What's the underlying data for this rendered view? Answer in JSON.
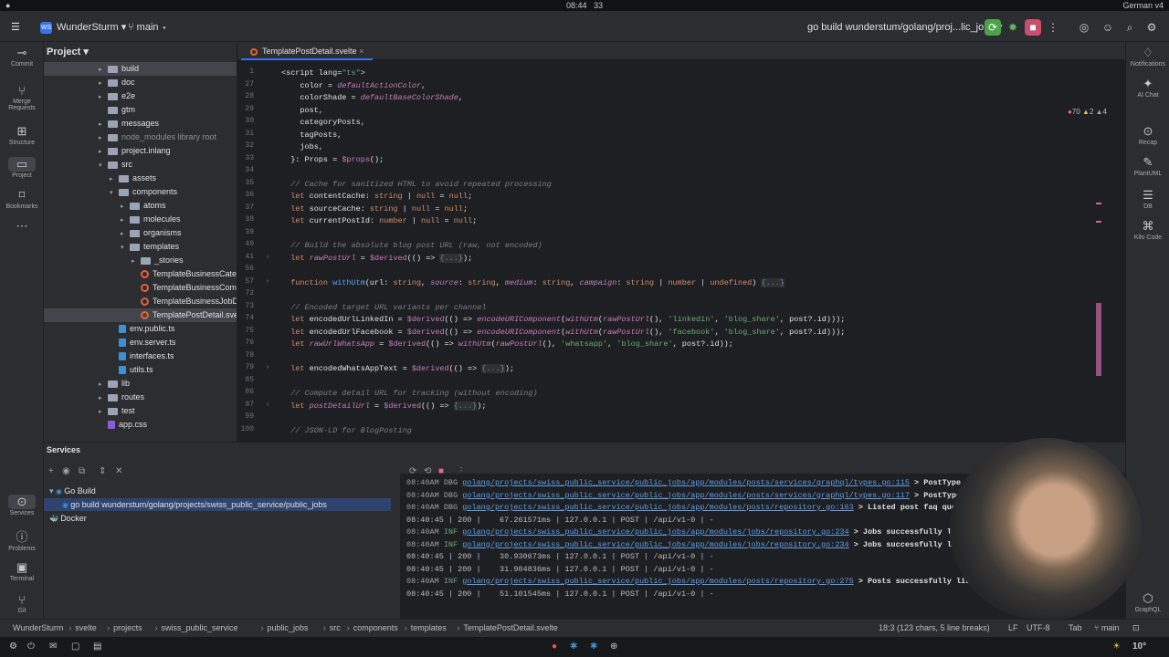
{
  "system": {
    "time": "08:44",
    "notif_count": "33",
    "language": "German",
    "version_label": "v4"
  },
  "titlebar": {
    "project_badge": "WS",
    "project_name": "WunderSturm",
    "branch": "main",
    "run_config": "go build wunderstum/golang/proj...lic_jobs"
  },
  "left_strip": [
    {
      "label": "Commit",
      "icon": "commit-icon"
    },
    {
      "label": "Merge Requests",
      "icon": "merge-icon"
    },
    {
      "label": "Structure",
      "icon": "structure-icon"
    },
    {
      "label": "Project",
      "icon": "folder-icon"
    },
    {
      "label": "Bookmarks",
      "icon": "bookmark-icon"
    }
  ],
  "left_strip_bottom": [
    {
      "label": "Services",
      "icon": "services-icon"
    },
    {
      "label": "Problems",
      "icon": "problems-icon"
    },
    {
      "label": "Terminal",
      "icon": "terminal-icon"
    },
    {
      "label": "Git",
      "icon": "git-icon"
    }
  ],
  "right_strip": [
    {
      "label": "Notifications"
    },
    {
      "label": "AI Chat"
    },
    {
      "label": "Recap"
    },
    {
      "label": "PlantUML"
    },
    {
      "label": "DB"
    },
    {
      "label": "Kilo Code"
    },
    {
      "label": "GraphQL"
    }
  ],
  "project_panel": {
    "title": "Project",
    "tree": [
      {
        "label": "build",
        "indent": 1,
        "kind": "folder",
        "arrow": ">",
        "style": "sel"
      },
      {
        "label": "doc",
        "indent": 1,
        "kind": "folder",
        "arrow": ">"
      },
      {
        "label": "e2e",
        "indent": 1,
        "kind": "folder",
        "arrow": ">"
      },
      {
        "label": "gtm",
        "indent": 1,
        "kind": "folder",
        "arrow": ""
      },
      {
        "label": "messages",
        "indent": 1,
        "kind": "folder",
        "arrow": ">"
      },
      {
        "label": "node_modules  library root",
        "indent": 1,
        "kind": "folder",
        "arrow": ">",
        "style": "dim"
      },
      {
        "label": "project.inlang",
        "indent": 1,
        "kind": "folder",
        "arrow": ">"
      },
      {
        "label": "src",
        "indent": 1,
        "kind": "folder",
        "arrow": "v"
      },
      {
        "label": "assets",
        "indent": 2,
        "kind": "folder",
        "arrow": ">"
      },
      {
        "label": "components",
        "indent": 2,
        "kind": "folder",
        "arrow": "v"
      },
      {
        "label": "atoms",
        "indent": 3,
        "kind": "folder",
        "arrow": ">"
      },
      {
        "label": "molecules",
        "indent": 3,
        "kind": "folder",
        "arrow": ">"
      },
      {
        "label": "organisms",
        "indent": 3,
        "kind": "folder",
        "arrow": ">"
      },
      {
        "label": "templates",
        "indent": 3,
        "kind": "folder",
        "arrow": "v"
      },
      {
        "label": "_stories",
        "indent": 4,
        "kind": "folder",
        "arrow": ">"
      },
      {
        "label": "TemplateBusinessCateg",
        "indent": 4,
        "kind": "svelte",
        "arrow": ""
      },
      {
        "label": "TemplateBusinessCompa",
        "indent": 4,
        "kind": "svelte",
        "arrow": ""
      },
      {
        "label": "TemplateBusinessJobDe",
        "indent": 4,
        "kind": "svelte",
        "arrow": ""
      },
      {
        "label": "TemplatePostDetail.svelt",
        "indent": 4,
        "kind": "svelte",
        "arrow": "",
        "style": "sel"
      },
      {
        "label": "env.public.ts",
        "indent": 2,
        "kind": "ts",
        "arrow": ""
      },
      {
        "label": "env.server.ts",
        "indent": 2,
        "kind": "ts",
        "arrow": ""
      },
      {
        "label": "interfaces.ts",
        "indent": 2,
        "kind": "ts",
        "arrow": ""
      },
      {
        "label": "utils.ts",
        "indent": 2,
        "kind": "ts",
        "arrow": ""
      },
      {
        "label": "lib",
        "indent": 1,
        "kind": "folder",
        "arrow": ">"
      },
      {
        "label": "routes",
        "indent": 1,
        "kind": "folder",
        "arrow": ">"
      },
      {
        "label": "test",
        "indent": 1,
        "kind": "folder",
        "arrow": ">"
      },
      {
        "label": "app.css",
        "indent": 1,
        "kind": "css",
        "arrow": ""
      }
    ]
  },
  "editor": {
    "tab": "TemplatePostDetail.svelte",
    "inspections": {
      "warn": "70",
      "weak": "2",
      "typo": "4"
    },
    "lines": [
      {
        "n": "1",
        "fold": "",
        "parts": [
          [
            "ty",
            "<script lang="
          ],
          [
            "s",
            "\"ts\""
          ],
          [
            "ty",
            ">"
          ]
        ]
      },
      {
        "n": "27",
        "fold": "",
        "parts": [
          [
            "ty",
            "    "
          ],
          [
            "ty",
            "color"
          ],
          [
            "ty",
            " = "
          ],
          [
            "it",
            "defaultActionColor"
          ],
          [
            "ty",
            ","
          ]
        ]
      },
      {
        "n": "28",
        "fold": "",
        "parts": [
          [
            "ty",
            "    colorShade = "
          ],
          [
            "it",
            "defaultBaseColorShade"
          ],
          [
            "ty",
            ","
          ]
        ]
      },
      {
        "n": "29",
        "fold": "",
        "parts": [
          [
            "ty",
            "    post,"
          ]
        ]
      },
      {
        "n": "30",
        "fold": "",
        "parts": [
          [
            "ty",
            "    categoryPosts,"
          ]
        ]
      },
      {
        "n": "31",
        "fold": "",
        "parts": [
          [
            "ty",
            "    tagPosts,"
          ]
        ]
      },
      {
        "n": "32",
        "fold": "",
        "parts": [
          [
            "ty",
            "    jobs,"
          ]
        ]
      },
      {
        "n": "33",
        "fold": "",
        "parts": [
          [
            "ty",
            "  }: Props = "
          ],
          [
            "pr",
            "$props"
          ],
          [
            "ty",
            "();"
          ]
        ]
      },
      {
        "n": "34",
        "fold": "",
        "parts": []
      },
      {
        "n": "35",
        "fold": "",
        "parts": [
          [
            "cm",
            "  // Cache for sanitized HTML to avoid repeated processing"
          ]
        ]
      },
      {
        "n": "36",
        "fold": "",
        "parts": [
          [
            "k",
            "  let "
          ],
          [
            "ty",
            "contentCache: "
          ],
          [
            "k",
            "string"
          ],
          [
            "ty",
            " | "
          ],
          [
            "k",
            "null"
          ],
          [
            "ty",
            " = "
          ],
          [
            "k",
            "null"
          ],
          [
            "ty",
            ";"
          ]
        ]
      },
      {
        "n": "37",
        "fold": "",
        "parts": [
          [
            "k",
            "  let "
          ],
          [
            "ty",
            "sourceCache: "
          ],
          [
            "k",
            "string"
          ],
          [
            "ty",
            " | "
          ],
          [
            "k",
            "null"
          ],
          [
            "ty",
            " = "
          ],
          [
            "k",
            "null"
          ],
          [
            "ty",
            ";"
          ]
        ]
      },
      {
        "n": "38",
        "fold": "",
        "parts": [
          [
            "k",
            "  let "
          ],
          [
            "ty",
            "currentPostId: "
          ],
          [
            "k",
            "number"
          ],
          [
            "ty",
            " | "
          ],
          [
            "k",
            "null"
          ],
          [
            "ty",
            " = "
          ],
          [
            "k",
            "null"
          ],
          [
            "ty",
            ";"
          ]
        ]
      },
      {
        "n": "39",
        "fold": "",
        "parts": []
      },
      {
        "n": "40",
        "fold": "",
        "parts": [
          [
            "cm",
            "  // Build the absolute blog post URL (raw, not encoded)"
          ]
        ]
      },
      {
        "n": "41",
        "fold": ">",
        "parts": [
          [
            "k",
            "  let "
          ],
          [
            "it",
            "rawPostUrl"
          ],
          [
            "ty",
            " = "
          ],
          [
            "pr",
            "$derived"
          ],
          [
            "ty",
            "(() => "
          ],
          [
            "col",
            "{...}"
          ],
          [
            "ty",
            ");"
          ]
        ]
      },
      {
        "n": "56",
        "fold": "",
        "parts": []
      },
      {
        "n": "57",
        "fold": ">",
        "parts": [
          [
            "k",
            "  function "
          ],
          [
            "fn",
            "withUtm"
          ],
          [
            "ty",
            "(url: "
          ],
          [
            "k",
            "string"
          ],
          [
            "ty",
            ", "
          ],
          [
            "it",
            "source"
          ],
          [
            "ty",
            ": "
          ],
          [
            "k",
            "string"
          ],
          [
            "ty",
            ", "
          ],
          [
            "it",
            "medium"
          ],
          [
            "ty",
            ": "
          ],
          [
            "k",
            "string"
          ],
          [
            "ty",
            ", "
          ],
          [
            "it",
            "campaign"
          ],
          [
            "ty",
            ": "
          ],
          [
            "k",
            "string"
          ],
          [
            "ty",
            " | "
          ],
          [
            "k",
            "number"
          ],
          [
            "ty",
            " | "
          ],
          [
            "k",
            "undefined"
          ],
          [
            "ty",
            ") "
          ],
          [
            "col",
            "{...}"
          ]
        ]
      },
      {
        "n": "72",
        "fold": "",
        "parts": []
      },
      {
        "n": "73",
        "fold": "",
        "parts": [
          [
            "cm",
            "  // Encoded target URL variants per channel"
          ]
        ]
      },
      {
        "n": "74",
        "fold": "",
        "parts": [
          [
            "k",
            "  let "
          ],
          [
            "ty",
            "encodedUrlLinkedIn = "
          ],
          [
            "pr",
            "$derived"
          ],
          [
            "ty",
            "(() => "
          ],
          [
            "it",
            "encodeURIComponent"
          ],
          [
            "ty",
            "("
          ],
          [
            "it",
            "withUtm"
          ],
          [
            "ty",
            "("
          ],
          [
            "it",
            "rawPostUrl"
          ],
          [
            "ty",
            "(), "
          ],
          [
            "s",
            "'linkedin'"
          ],
          [
            "ty",
            ", "
          ],
          [
            "s",
            "'blog_share'"
          ],
          [
            "ty",
            ", post?.id)));"
          ]
        ]
      },
      {
        "n": "75",
        "fold": "",
        "parts": [
          [
            "k",
            "  let "
          ],
          [
            "ty",
            "encodedUrlFacebook = "
          ],
          [
            "pr",
            "$derived"
          ],
          [
            "ty",
            "(() => "
          ],
          [
            "it",
            "encodeURIComponent"
          ],
          [
            "ty",
            "("
          ],
          [
            "it",
            "withUtm"
          ],
          [
            "ty",
            "("
          ],
          [
            "it",
            "rawPostUrl"
          ],
          [
            "ty",
            "(), "
          ],
          [
            "s",
            "'facebook'"
          ],
          [
            "ty",
            ", "
          ],
          [
            "s",
            "'blog_share'"
          ],
          [
            "ty",
            ", post?.id)));"
          ]
        ]
      },
      {
        "n": "76",
        "fold": "",
        "parts": [
          [
            "k",
            "  let "
          ],
          [
            "it",
            "rawUrlWhatsApp"
          ],
          [
            "ty",
            " = "
          ],
          [
            "pr",
            "$derived"
          ],
          [
            "ty",
            "(() => "
          ],
          [
            "it",
            "withUtm"
          ],
          [
            "ty",
            "("
          ],
          [
            "it",
            "rawPostUrl"
          ],
          [
            "ty",
            "(), "
          ],
          [
            "s",
            "'whatsapp'"
          ],
          [
            "ty",
            ", "
          ],
          [
            "s",
            "'blog_share'"
          ],
          [
            "ty",
            ", post?.id));"
          ]
        ]
      },
      {
        "n": "78",
        "fold": "",
        "parts": []
      },
      {
        "n": "79",
        "fold": ">",
        "parts": [
          [
            "k",
            "  let "
          ],
          [
            "ty",
            "encodedWhatsAppText = "
          ],
          [
            "pr",
            "$derived"
          ],
          [
            "ty",
            "(() => "
          ],
          [
            "col",
            "{...}"
          ],
          [
            "ty",
            ");"
          ]
        ]
      },
      {
        "n": "85",
        "fold": "",
        "parts": []
      },
      {
        "n": "86",
        "fold": "",
        "parts": [
          [
            "cm",
            "  // Compute detail URL for tracking (without encoding)"
          ]
        ]
      },
      {
        "n": "87",
        "fold": ">",
        "parts": [
          [
            "k",
            "  let "
          ],
          [
            "it",
            "postDetailUrl"
          ],
          [
            "ty",
            " = "
          ],
          [
            "pr",
            "$derived"
          ],
          [
            "ty",
            "(() => "
          ],
          [
            "col",
            "{...}"
          ],
          [
            "ty",
            ");"
          ]
        ]
      },
      {
        "n": "99",
        "fold": "",
        "parts": []
      },
      {
        "n": "100",
        "fold": "",
        "parts": [
          [
            "cm",
            "  // JSON-LD for BlogPosting"
          ]
        ]
      }
    ]
  },
  "services": {
    "title": "Services",
    "tree": [
      {
        "label": "Go Build",
        "indent": 0,
        "arrow": "v"
      },
      {
        "label": "go build wunderstum/golang/projects/swiss_public_service/public_jobs",
        "indent": 1,
        "arrow": "",
        "style": "sel"
      },
      {
        "label": "Docker",
        "indent": 0,
        "arrow": ""
      }
    ],
    "log": [
      {
        "ts": "08:40AM",
        "lvl": "DBG",
        "path": "golang/projects/swiss_public_service/public_jobs/app/modules/posts/services/graphql/types.go:115",
        "msg": " > PostType.faq"
      },
      {
        "ts": "08:40AM",
        "lvl": "DBG",
        "path": "golang/projects/swiss_public_service/public_jobs/app/modules/posts/services/graphql/types.go:117",
        "msg": " > PostType.faq"
      },
      {
        "ts": "08:40AM",
        "lvl": "DBG",
        "path": "golang/projects/swiss_public_service/public_jobs/app/modules/posts/repository.go:163",
        "msg": " > Listed post faq question"
      },
      {
        "plain": "08:40:45 | 200 |    67.261571ms | 127.0.0.1 | POST | /api/v1-0 | -"
      },
      {
        "ts": "08:40AM",
        "lvl": "INF",
        "path": "golang/projects/swiss_public_service/public_jobs/app/modules/jobs/repository.go:234",
        "msg": " > Jobs successfully listed"
      },
      {
        "ts": "08:40AM",
        "lvl": "INF",
        "path": "golang/projects/swiss_public_service/public_jobs/app/modules/jobs/repository.go:234",
        "msg": " > Jobs successfully listed"
      },
      {
        "plain": "08:40:45 | 200 |    30.930673ms | 127.0.0.1 | POST | /api/v1-0 | -"
      },
      {
        "plain": "08:40:45 | 200 |    31.904836ms | 127.0.0.1 | POST | /api/v1-0 | -"
      },
      {
        "ts": "08:40AM",
        "lvl": "INF",
        "path": "golang/projects/swiss_public_service/public_jobs/app/modules/posts/repository.go:275",
        "msg": " > Posts successfully listed fr"
      },
      {
        "plain": "08:40:45 | 200 |    51.101545ms | 127.0.0.1 | POST | /api/v1-0 | -"
      }
    ]
  },
  "statusbar": {
    "crumbs": [
      "WunderSturm",
      "svelte",
      "projects",
      "swiss_public_service",
      "public_jobs",
      "src",
      "components",
      "templates",
      "TemplatePostDetail.svelte"
    ],
    "position": "18:3 (123 chars, 5 line breaks)",
    "eol": "LF",
    "encoding": "UTF-8",
    "indent": "Tab",
    "branch": "main"
  },
  "taskbar": {
    "weather": "10°"
  }
}
